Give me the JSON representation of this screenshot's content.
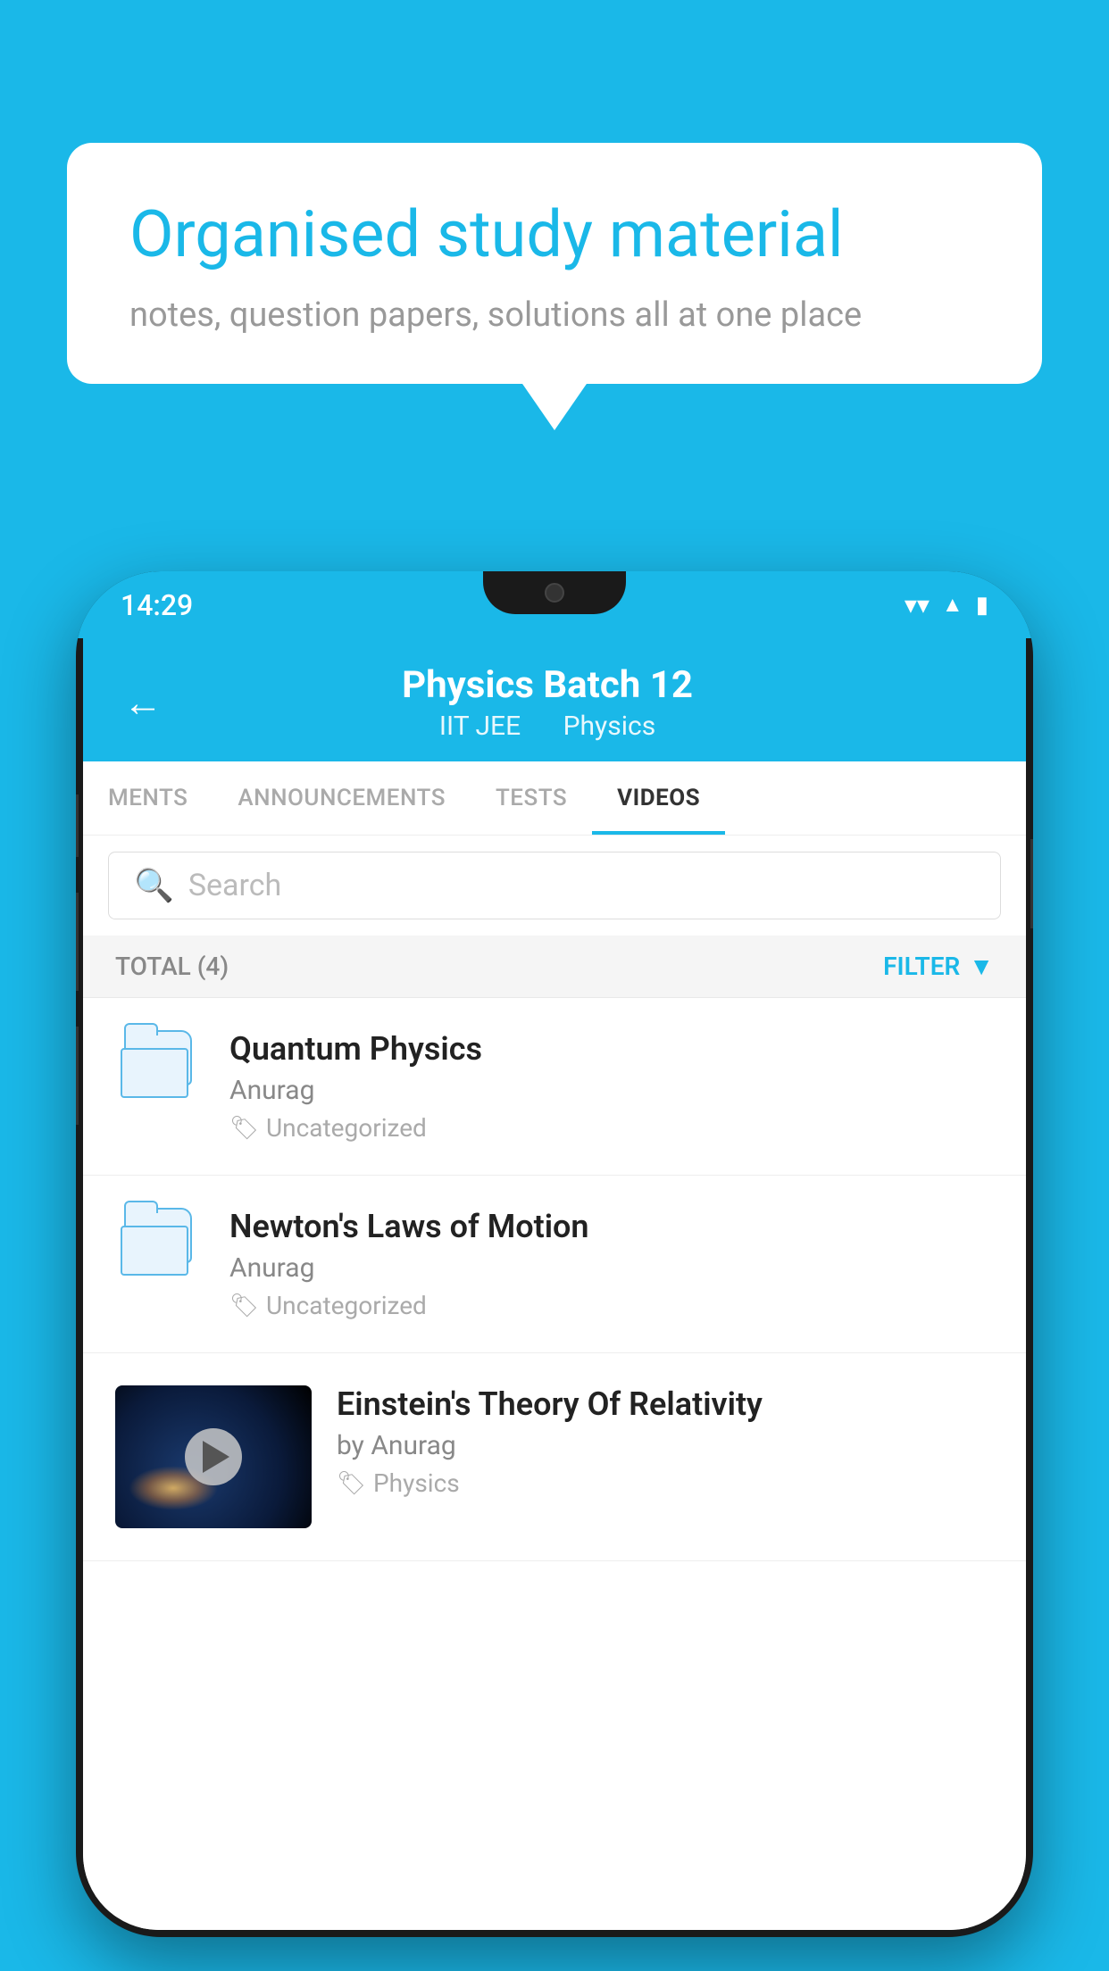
{
  "background_color": "#1ab8e8",
  "speech_bubble": {
    "title": "Organised study material",
    "subtitle": "notes, question papers, solutions all at one place"
  },
  "phone": {
    "status_bar": {
      "time": "14:29",
      "icons": [
        "wifi",
        "signal",
        "battery"
      ]
    },
    "header": {
      "back_label": "←",
      "title": "Physics Batch 12",
      "subtitle_part1": "IIT JEE",
      "subtitle_part2": "Physics"
    },
    "tabs": [
      {
        "label": "MENTS",
        "active": false
      },
      {
        "label": "ANNOUNCEMENTS",
        "active": false
      },
      {
        "label": "TESTS",
        "active": false
      },
      {
        "label": "VIDEOS",
        "active": true
      }
    ],
    "search": {
      "placeholder": "Search"
    },
    "filter_row": {
      "total_label": "TOTAL (4)",
      "filter_label": "FILTER"
    },
    "videos": [
      {
        "id": 1,
        "title": "Quantum Physics",
        "author": "Anurag",
        "tag": "Uncategorized",
        "type": "folder"
      },
      {
        "id": 2,
        "title": "Newton's Laws of Motion",
        "author": "Anurag",
        "tag": "Uncategorized",
        "type": "folder"
      },
      {
        "id": 3,
        "title": "Einstein's Theory Of Relativity",
        "author": "by Anurag",
        "tag": "Physics",
        "type": "video"
      }
    ]
  }
}
